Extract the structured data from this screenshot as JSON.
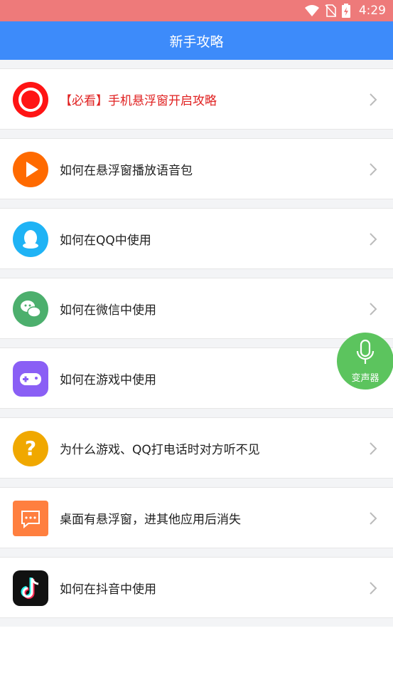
{
  "status_bar": {
    "time": "4:29"
  },
  "app_bar": {
    "title": "新手攻略"
  },
  "items": [
    {
      "label": "【必看】手机悬浮窗开启攻略",
      "icon": "record-icon",
      "color": "#ff1414",
      "highlight": true
    },
    {
      "label": "如何在悬浮窗播放语音包",
      "icon": "play-icon",
      "color": "#ff6a00"
    },
    {
      "label": "如何在QQ中使用",
      "icon": "qq-icon",
      "color": "#1fb3f5"
    },
    {
      "label": "如何在微信中使用",
      "icon": "wechat-icon",
      "color": "#4caf6d"
    },
    {
      "label": "如何在游戏中使用",
      "icon": "gamepad-icon",
      "color": "#8a5ff5"
    },
    {
      "label": "为什么游戏、QQ打电话时对方听不见",
      "icon": "question-icon",
      "color": "#f0a800"
    },
    {
      "label": "桌面有悬浮窗，进其他应用后消失",
      "icon": "message-icon",
      "color": "#ff7f3f"
    },
    {
      "label": "如何在抖音中使用",
      "icon": "tiktok-icon",
      "color": "#111111"
    }
  ],
  "fab": {
    "label": "变声器",
    "icon": "microphone-icon",
    "color": "#5cc45e"
  },
  "colors": {
    "status_bar": "#ee7a7a",
    "app_bar": "#3d8bfa",
    "accent_red": "#e02020"
  }
}
